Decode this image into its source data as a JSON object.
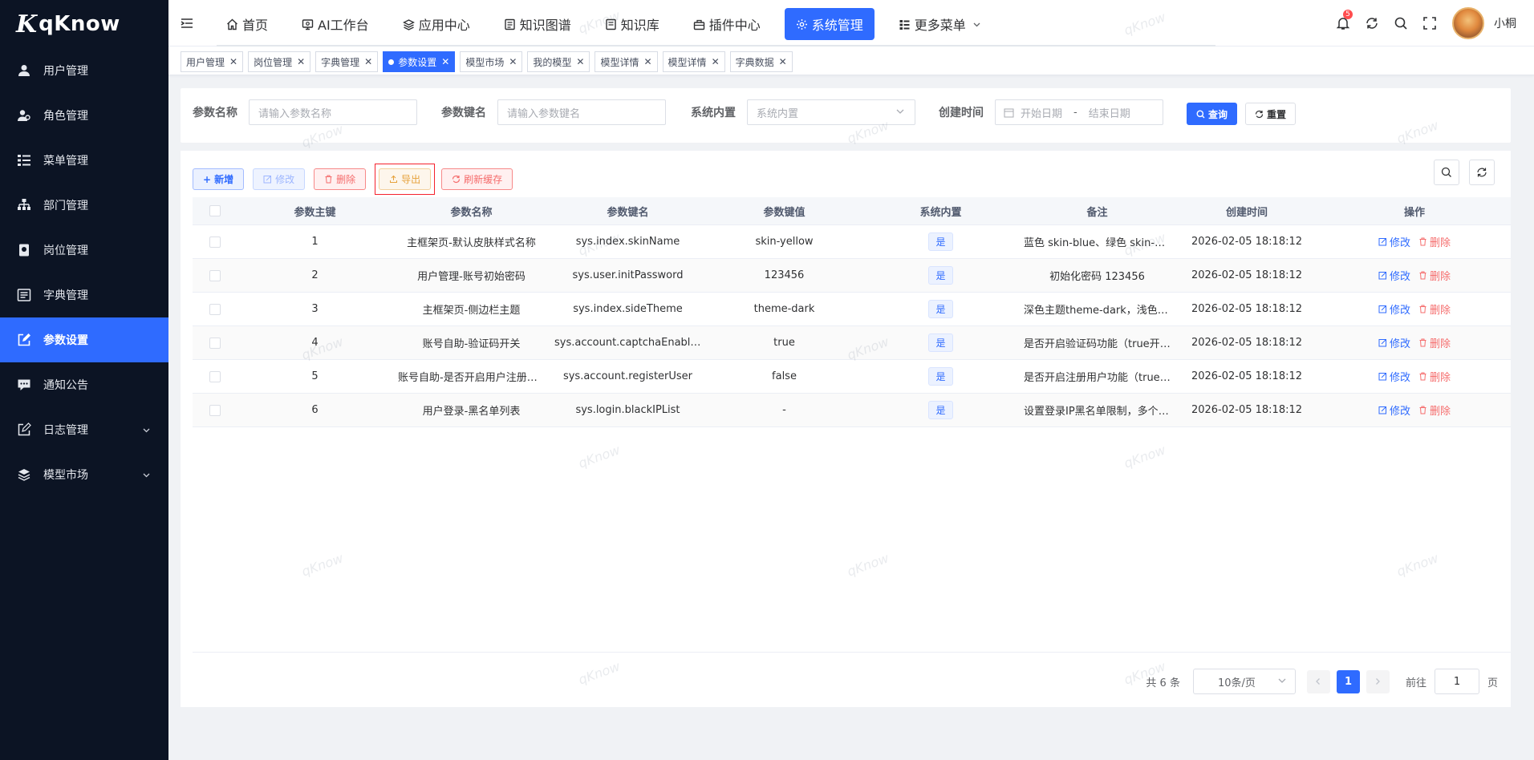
{
  "brand": {
    "mark": "K",
    "name": "qKnow"
  },
  "sidebar": {
    "items": [
      {
        "label": "用户管理",
        "icon": "user-icon"
      },
      {
        "label": "角色管理",
        "icon": "role-icon"
      },
      {
        "label": "菜单管理",
        "icon": "menu-tree-icon"
      },
      {
        "label": "部门管理",
        "icon": "org-tree-icon"
      },
      {
        "label": "岗位管理",
        "icon": "post-icon"
      },
      {
        "label": "字典管理",
        "icon": "dict-icon"
      },
      {
        "label": "参数设置",
        "icon": "edit-icon",
        "active": true
      },
      {
        "label": "通知公告",
        "icon": "message-icon"
      },
      {
        "label": "日志管理",
        "icon": "log-icon",
        "expandable": true
      },
      {
        "label": "模型市场",
        "icon": "model-icon",
        "expandable": true
      }
    ]
  },
  "topnav": {
    "items": [
      {
        "label": "首页",
        "icon": "home-icon"
      },
      {
        "label": "AI工作台",
        "icon": "monitor-icon"
      },
      {
        "label": "应用中心",
        "icon": "app-icon"
      },
      {
        "label": "知识图谱",
        "icon": "graph-icon"
      },
      {
        "label": "知识库",
        "icon": "book-icon"
      },
      {
        "label": "插件中心",
        "icon": "plugin-icon"
      },
      {
        "label": "系统管理",
        "icon": "gear-icon",
        "active": true
      },
      {
        "label": "更多菜单",
        "icon": "more-icon",
        "dropdown": true
      }
    ],
    "notification_count": "5",
    "username": "小桐"
  },
  "tags": [
    {
      "label": "用户管理"
    },
    {
      "label": "岗位管理"
    },
    {
      "label": "字典管理"
    },
    {
      "label": "参数设置",
      "active": true
    },
    {
      "label": "模型市场"
    },
    {
      "label": "我的模型"
    },
    {
      "label": "模型详情"
    },
    {
      "label": "模型详情"
    },
    {
      "label": "字典数据"
    }
  ],
  "search": {
    "param_name_label": "参数名称",
    "param_name_placeholder": "请输入参数名称",
    "param_key_label": "参数键名",
    "param_key_placeholder": "请输入参数键名",
    "builtin_label": "系统内置",
    "builtin_placeholder": "系统内置",
    "created_label": "创建时间",
    "start_placeholder": "开始日期",
    "range_sep": "-",
    "end_placeholder": "结束日期",
    "query_label": "查询",
    "reset_label": "重置"
  },
  "toolbar": {
    "add_label": "新增",
    "edit_label": "修改",
    "delete_label": "删除",
    "export_label": "导出",
    "refresh_label": "刷新缓存"
  },
  "table": {
    "columns": [
      "参数主键",
      "参数名称",
      "参数键名",
      "参数键值",
      "系统内置",
      "备注",
      "创建时间",
      "操作"
    ],
    "rows": [
      {
        "id": "1",
        "name": "主框架页-默认皮肤样式名称",
        "key": "sys.index.skinName",
        "value": "skin-yellow",
        "builtin": "是",
        "remark": "蓝色 skin-blue、绿色 skin-green、紫色 skin-purple",
        "created": "2026-02-05 18:18:12"
      },
      {
        "id": "2",
        "name": "用户管理-账号初始密码",
        "key": "sys.user.initPassword",
        "value": "123456",
        "builtin": "是",
        "remark": "初始化密码 123456",
        "created": "2026-02-05 18:18:12"
      },
      {
        "id": "3",
        "name": "主框架页-侧边栏主题",
        "key": "sys.index.sideTheme",
        "value": "theme-dark",
        "builtin": "是",
        "remark": "深色主题theme-dark，浅色主题theme-light",
        "created": "2026-02-05 18:18:12"
      },
      {
        "id": "4",
        "name": "账号自助-验证码开关",
        "key": "sys.account.captchaEnabled",
        "value": "true",
        "builtin": "是",
        "remark": "是否开启验证码功能（true开启，false关闭）",
        "created": "2026-02-05 18:18:12"
      },
      {
        "id": "5",
        "name": "账号自助-是否开启用户注册功能",
        "key": "sys.account.registerUser",
        "value": "false",
        "builtin": "是",
        "remark": "是否开启注册用户功能（true开启，false关闭）",
        "created": "2026-02-05 18:18:12"
      },
      {
        "id": "6",
        "name": "用户登录-黑名单列表",
        "key": "sys.login.blackIPList",
        "value": "-",
        "builtin": "是",
        "remark": "设置登录IP黑名单限制，多个匹配项以;分隔",
        "created": "2026-02-05 18:18:12"
      }
    ],
    "edit_label": "修改",
    "delete_label": "删除"
  },
  "pagination": {
    "total_text": "共 6 条",
    "page_size": "10条/页",
    "current_page": "1",
    "goto_label": "前往",
    "goto_value": "1",
    "page_suffix": "页"
  },
  "watermark": "qKnow",
  "colors": {
    "accent": "#2f6bff",
    "sidebar_bg": "#0c1424",
    "danger": "#f56c6c",
    "warning": "#e6a23c"
  }
}
